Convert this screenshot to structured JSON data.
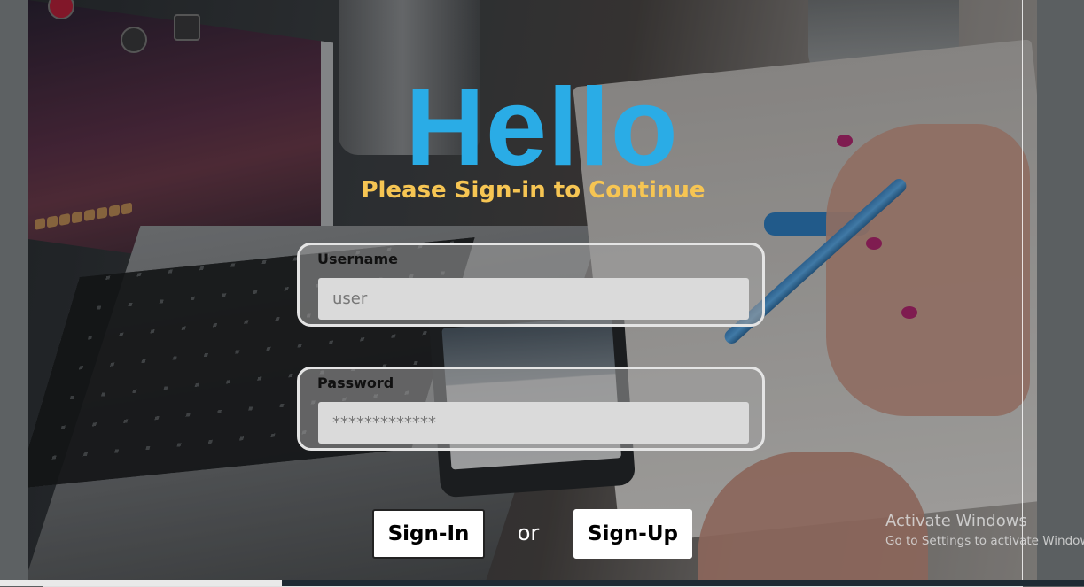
{
  "header": {
    "title": "Hello",
    "subtitle": "Please Sign-in to Continue"
  },
  "form": {
    "username": {
      "label": "Username",
      "placeholder": "user"
    },
    "password": {
      "label": "Password",
      "placeholder": "*************"
    }
  },
  "actions": {
    "signin_label": "Sign-In",
    "separator": "or",
    "signup_label": "Sign-Up"
  },
  "watermark": {
    "title": "Activate Windows",
    "subtitle": "Go to Settings to activate Windows."
  },
  "colors": {
    "title": "#2aace6",
    "subtitle": "#f6c553",
    "card_border": "#e4e4e4",
    "input_bg": "#dadada"
  }
}
